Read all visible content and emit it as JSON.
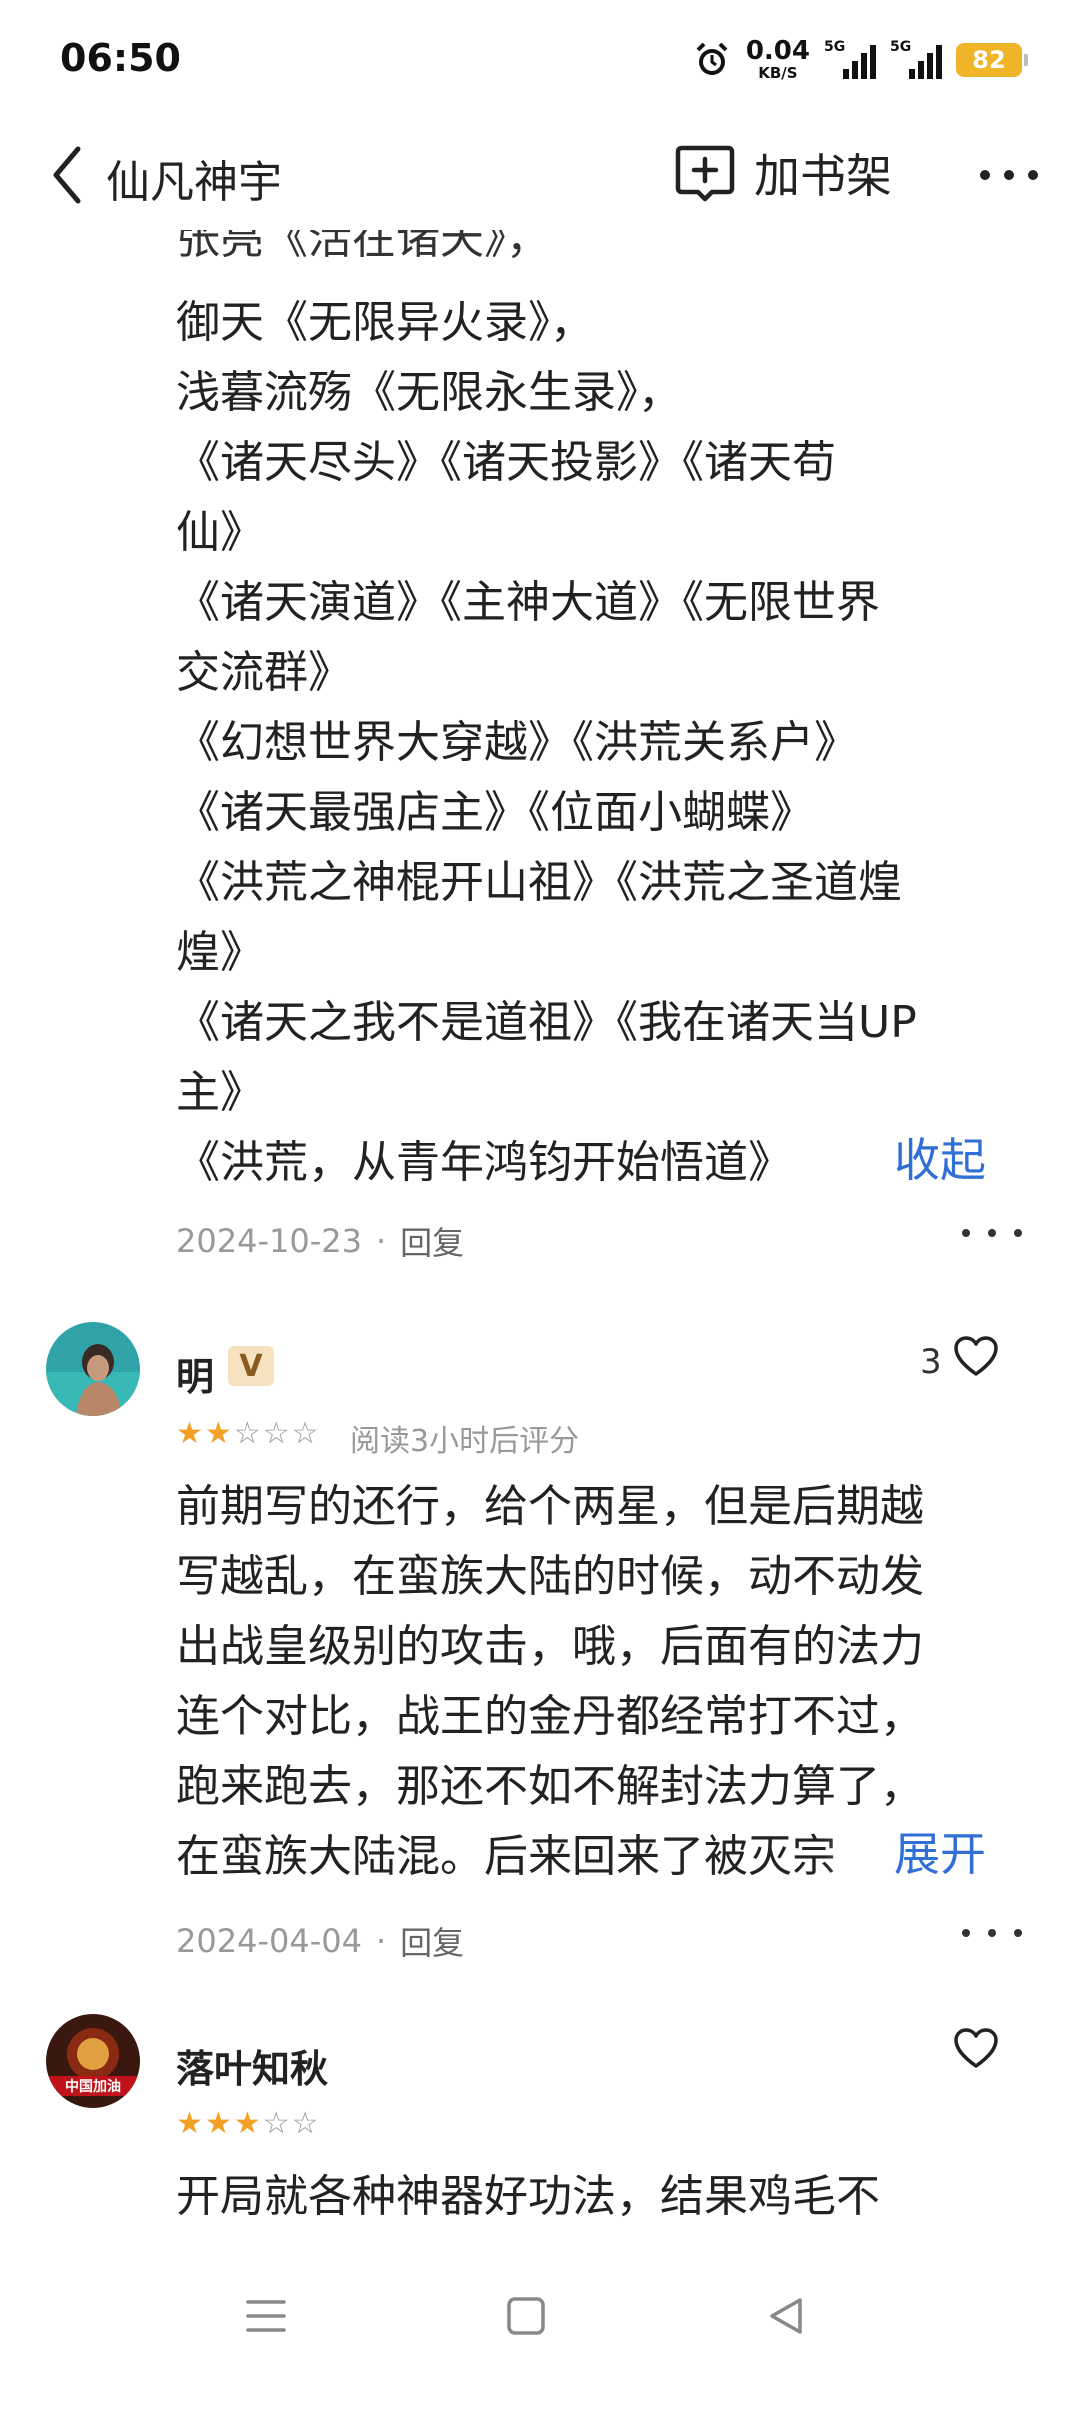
{
  "status": {
    "time": "06:50",
    "net_speed": "0.04",
    "net_unit": "KB/S",
    "sim1_label": "5G",
    "sim2_label": "5G",
    "battery": "82"
  },
  "header": {
    "title": "仙凡神宇",
    "add_shelf_label": "加书架"
  },
  "comment1": {
    "lines": [
      "张亮《活在诸天》，",
      "御天《无限异火录》，",
      "浅暮流殇《无限永生录》，",
      "《诸天尽头》《诸天投影》《诸天苟",
      "仙》",
      "《诸天演道》《主神大道》《无限世界",
      "交流群》",
      "《幻想世界大穿越》《洪荒关系户》",
      "《诸天最强店主》《位面小蝴蝶》",
      "《洪荒之神棍开山祖》《洪荒之圣道煌",
      "煌》",
      "《诸天之我不是道祖》《我在诸天当UP",
      "主》",
      "《洪荒，从青年鸿钧开始悟道》"
    ],
    "collapse_label": "收起",
    "date": "2024-10-23",
    "reply_label": "回复"
  },
  "comment2": {
    "username": "明",
    "badge": "V",
    "likes": "3",
    "rating": 2,
    "rating_max": 5,
    "rating_note": "阅读3小时后评分",
    "lines": [
      "前期写的还行，给个两星，但是后期越",
      "写越乱，在蛮族大陆的时候，动不动发",
      "出战皇级别的攻击，哦，后面有的法力",
      "连个对比，战王的金丹都经常打不过，",
      "跑来跑去，那还不如不解封法力算了，",
      "在蛮族大陆混。后来回来了被灭宗"
    ],
    "expand_label": "展开",
    "date": "2024-04-04",
    "reply_label": "回复"
  },
  "comment3": {
    "username": "落叶知秋",
    "avatar_text": "中国加油",
    "rating": 3,
    "rating_max": 5,
    "lines": [
      "开局就各种神器好功法，结果鸡毛不"
    ]
  },
  "colors": {
    "accent_link": "#2f6fd6",
    "star": "#f2a126",
    "battery": "#f0b429"
  },
  "icons": [
    "back-chevron-icon",
    "add-bookshelf-icon",
    "more-icon",
    "heart-icon",
    "menu-icon",
    "home-square-icon",
    "back-triangle-icon"
  ]
}
